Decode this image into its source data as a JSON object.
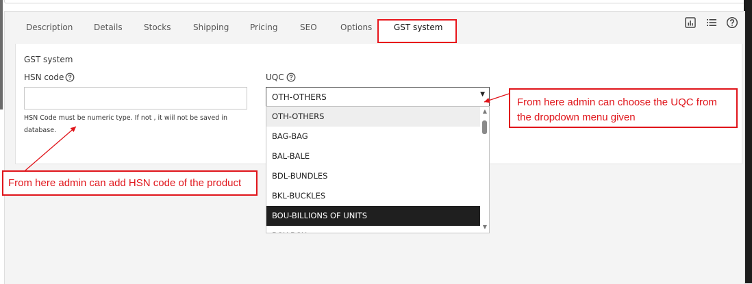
{
  "tabs": [
    {
      "label": "Description"
    },
    {
      "label": "Details"
    },
    {
      "label": "Stocks"
    },
    {
      "label": "Shipping"
    },
    {
      "label": "Pricing"
    },
    {
      "label": "SEO"
    },
    {
      "label": "Options"
    },
    {
      "label": "GST system",
      "active": true
    }
  ],
  "toolbar_icons": [
    "bar-chart-icon",
    "list-icon",
    "help-circle-icon"
  ],
  "section": {
    "title": "GST system"
  },
  "hsn": {
    "label": "HSN code",
    "value": "",
    "helper_text": "HSN Code must be numeric type. If not , it wiil not be saved in database."
  },
  "uqc": {
    "label": "UQC",
    "selected_value": "OTH-OTHERS",
    "options": [
      "OTH-OTHERS",
      "BAG-BAG",
      "BAL-BALE",
      "BDL-BUNDLES",
      "BKL-BUCKLES",
      "BOU-BILLIONS OF UNITS"
    ],
    "highlighted_option": "BOU-BILLIONS OF UNITS",
    "partially_visible_option": "BOX-BOX"
  },
  "annotations": {
    "uqc_note": "From here admin can choose the UQC from the dropdown menu given",
    "hsn_note": "From here admin can add HSN code of the product"
  },
  "colors": {
    "annotation_red": "#e0141a",
    "highlight_bg": "#1f1f1f",
    "panel_bg": "#f4f4f4"
  }
}
